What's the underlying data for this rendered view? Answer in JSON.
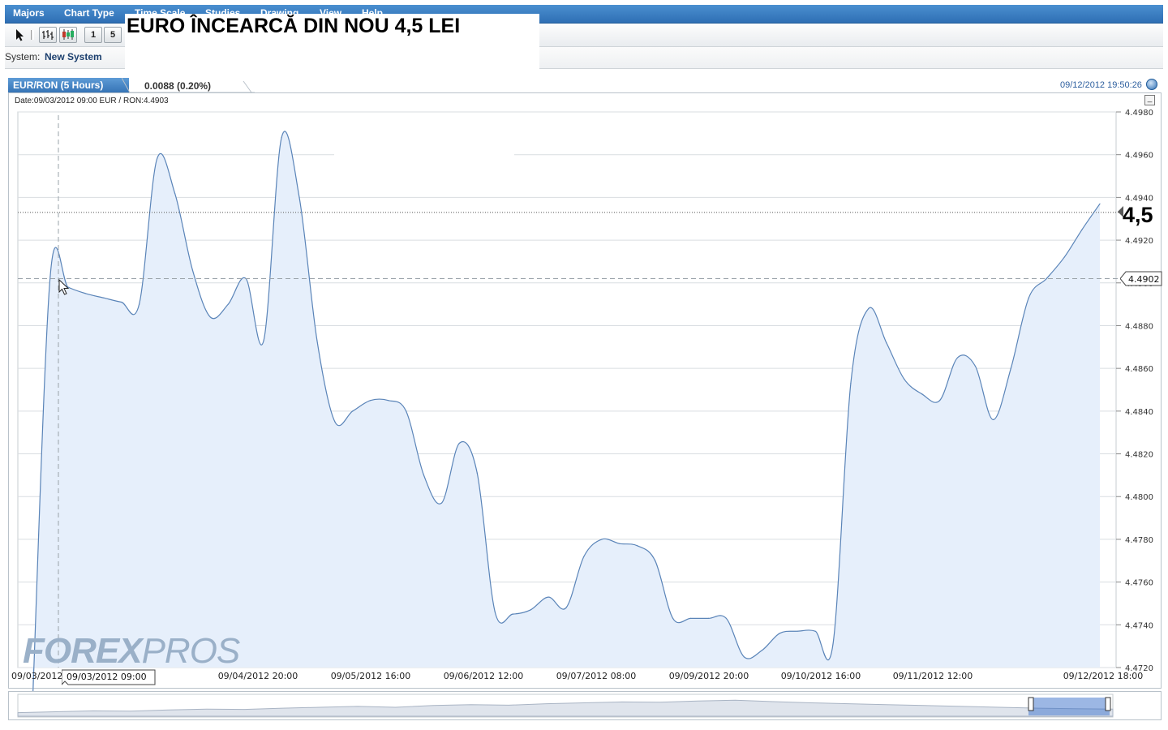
{
  "menu": [
    "Majors",
    "Chart Type",
    "Time Scale",
    "Studies",
    "Drawing",
    "View",
    "Help"
  ],
  "toolbar": {
    "btn_1": "1",
    "btn_5": "5"
  },
  "system": {
    "label": "System:",
    "value": "New System"
  },
  "headline": "EURO ÎNCEARCĂ DIN NOU 4,5 LEI",
  "tab": {
    "label": "EUR/RON (5 Hours)",
    "change": "0.0088 (0.20%)"
  },
  "timestamp": "09/12/2012 19:50:26",
  "info": "Date:09/03/2012 09:00 EUR / RON:4.4903",
  "current_price_tag": "4.4902",
  "big_label": "4,5",
  "crosshair_label": "09/03/2012 09:00",
  "logo": {
    "part1": "FOREX",
    "part2": "PROS"
  },
  "colors": {
    "line": "#5a84b8",
    "fill": "#e6effb",
    "grid": "#d9dde1",
    "menu": "#3a7cc2"
  },
  "chart_data": {
    "type": "area",
    "series": [
      {
        "values": [
          4.4702,
          4.4903,
          4.4898,
          4.4895,
          4.4893,
          4.4891,
          4.489,
          4.4958,
          4.4942,
          4.4906,
          4.4884,
          4.489,
          4.4902,
          4.4873,
          4.4968,
          4.494,
          4.4873,
          4.4835,
          4.484,
          4.4845,
          4.4845,
          4.484,
          4.481,
          4.4797,
          4.4825,
          4.4811,
          4.4746,
          4.4745,
          4.4747,
          4.4753,
          4.4748,
          4.4772,
          4.478,
          4.4778,
          4.4777,
          4.477,
          4.4743,
          4.4743,
          4.4743,
          4.4743,
          4.4725,
          4.4728,
          4.4736,
          4.4737,
          4.4737,
          4.4731,
          4.4853,
          4.4888,
          4.4872,
          4.4855,
          4.4848,
          4.4845,
          4.4865,
          4.4861,
          4.4836,
          4.486,
          4.4893,
          4.4902,
          4.4912,
          4.4925,
          4.4937
        ]
      }
    ],
    "x_tick_labels": [
      "09/03/2012 09:00",
      "09/04/2012 20:00",
      "09/05/2012 16:00",
      "09/06/2012 12:00",
      "09/07/2012 08:00",
      "09/09/2012 20:00",
      "09/10/2012 16:00",
      "09/11/2012 12:00",
      "09/12/2012 18:00"
    ],
    "y_ticks": [
      4.472,
      4.474,
      4.476,
      4.478,
      4.48,
      4.482,
      4.484,
      4.486,
      4.488,
      4.49,
      4.492,
      4.494,
      4.496,
      4.498
    ],
    "ylim": [
      4.472,
      4.498
    ],
    "reference_line": 4.4933,
    "crosshair_value": 4.4902,
    "grid": true
  }
}
